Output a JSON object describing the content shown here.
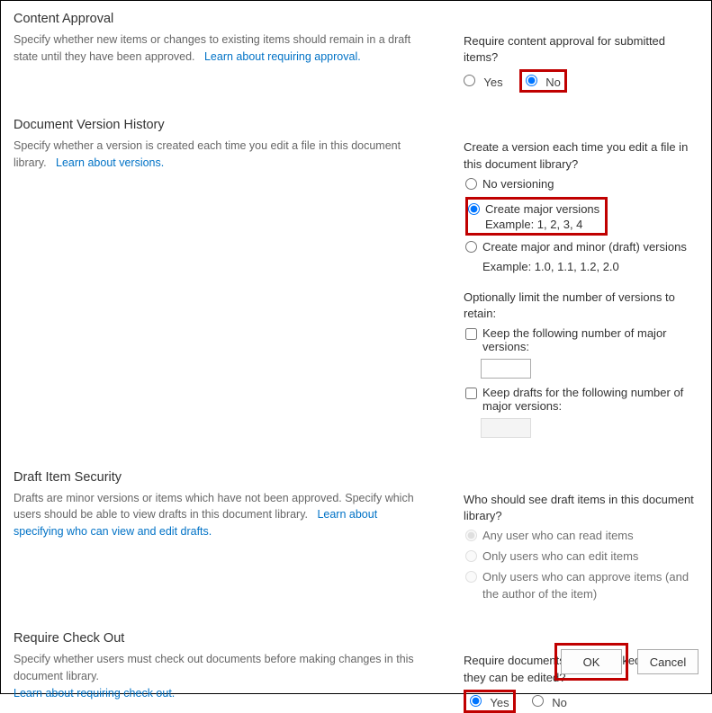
{
  "contentApproval": {
    "title": "Content Approval",
    "desc": "Specify whether new items or changes to existing items should remain in a draft state until they have been approved.",
    "link": "Learn about requiring approval.",
    "question": "Require content approval for submitted items?",
    "yes": "Yes",
    "no": "No"
  },
  "versionHistory": {
    "title": "Document Version History",
    "desc": "Specify whether a version is created each time you edit a file in this document library.",
    "link": "Learn about versions.",
    "question": "Create a version each time you edit a file in this document library?",
    "optNone": "No versioning",
    "optMajor": "Create major versions",
    "optMajorEx": "Example: 1, 2, 3, 4",
    "optMinor": "Create major and minor (draft) versions",
    "optMinorEx": "Example: 1.0, 1.1, 1.2, 2.0",
    "limitLabel": "Optionally limit the number of versions to retain:",
    "keepMajor": "Keep the following number of major versions:",
    "keepDrafts": "Keep drafts for the following number of major versions:"
  },
  "draftSecurity": {
    "title": "Draft Item Security",
    "desc": "Drafts are minor versions or items which have not been approved. Specify which users should be able to view drafts in this document library.",
    "link": "Learn about specifying who can view and edit drafts.",
    "question": "Who should see draft items in this document library?",
    "optRead": "Any user who can read items",
    "optEdit": "Only users who can edit items",
    "optApprove": "Only users who can approve items (and the author of the item)"
  },
  "checkout": {
    "title": "Require Check Out",
    "desc": "Specify whether users must check out documents before making changes in this document library.",
    "link": "Learn about requiring check out.",
    "question": "Require documents to be checked out before they can be edited?",
    "yes": "Yes",
    "no": "No"
  },
  "footer": {
    "ok": "OK",
    "cancel": "Cancel"
  }
}
